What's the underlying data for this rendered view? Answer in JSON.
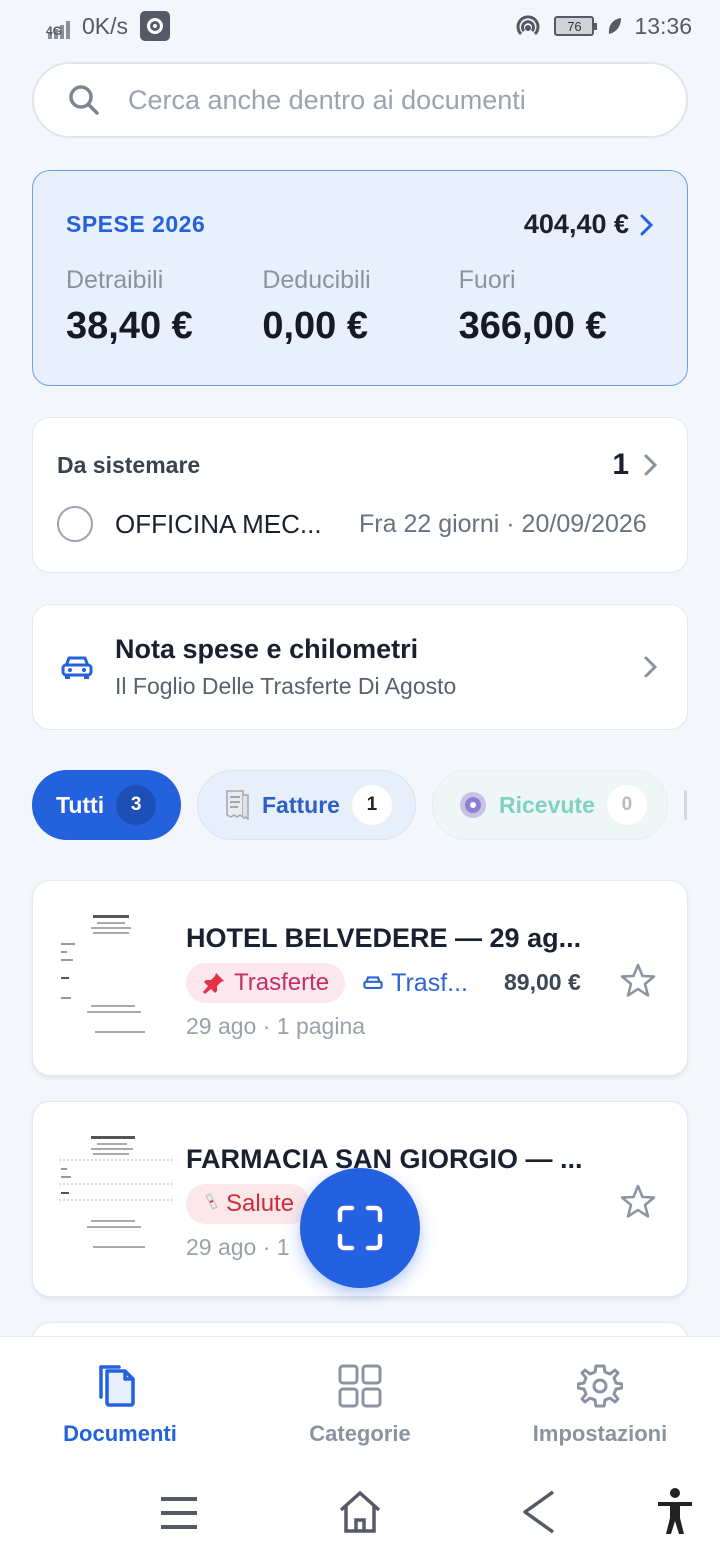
{
  "status_bar": {
    "network": "4G",
    "speed": "0K/s",
    "battery": "76",
    "time": "13:36"
  },
  "search": {
    "placeholder": "Cerca anche dentro ai documenti"
  },
  "expenses": {
    "title": "SPESE 2026",
    "total": "404,40 €",
    "columns": [
      {
        "label": "Detraibili",
        "value": "38,40 €"
      },
      {
        "label": "Deducibili",
        "value": "0,00 €"
      },
      {
        "label": "Fuori",
        "value": "366,00 €"
      }
    ]
  },
  "to_fix": {
    "title": "Da sistemare",
    "count": "1",
    "item": {
      "name": "OFFICINA MEC...",
      "meta": "Fra 22 giorni · 20/09/2026"
    }
  },
  "expense_report": {
    "title": "Nota spese e chilometri",
    "subtitle": "Il Foglio Delle Trasferte Di Agosto"
  },
  "filters": [
    {
      "label": "Tutti",
      "count": "3",
      "icon": "none"
    },
    {
      "label": "Fatture",
      "count": "1",
      "icon": "receipt-icon"
    },
    {
      "label": "Ricevute",
      "count": "0",
      "icon": "disc-icon"
    }
  ],
  "documents": [
    {
      "title": "HOTEL BELVEDERE — 29 ag...",
      "tag": "Trasferte",
      "tag_icon": "pushpin-icon",
      "category": "Trasf...",
      "amount": "89,00 €",
      "meta": "29 ago · 1 pagina",
      "starred": false
    },
    {
      "title": "FARMACIA SAN GIORGIO — ...",
      "tag": "Salute",
      "tag_icon": "pill-icon",
      "meta": "29 ago · 1",
      "starred": false
    }
  ],
  "bottom_nav": [
    {
      "label": "Documenti",
      "icon": "documents-icon",
      "active": true
    },
    {
      "label": "Categorie",
      "icon": "grid-icon",
      "active": false
    },
    {
      "label": "Impostazioni",
      "icon": "gear-icon",
      "active": false
    }
  ],
  "colors": {
    "accent": "#2461dd",
    "card_highlight": "#e7f0fb",
    "tag_pink": "#c23062",
    "tag_red": "#d02b3a"
  }
}
